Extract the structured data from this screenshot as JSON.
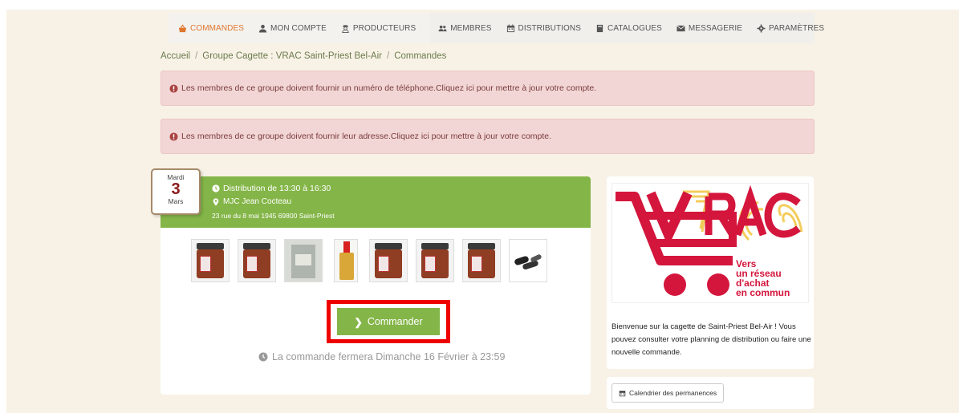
{
  "nav": {
    "left": [
      {
        "label": "COMMANDES",
        "icon": "basket-icon",
        "active": true
      },
      {
        "label": "MON COMPTE",
        "icon": "user-icon",
        "active": false
      },
      {
        "label": "PRODUCTEURS",
        "icon": "farmer-icon",
        "active": false
      }
    ],
    "right": [
      {
        "label": "MEMBRES",
        "icon": "users-icon"
      },
      {
        "label": "DISTRIBUTIONS",
        "icon": "calendar-icon"
      },
      {
        "label": "CATALOGUES",
        "icon": "book-icon"
      },
      {
        "label": "MESSAGERIE",
        "icon": "envelope-icon"
      },
      {
        "label": "PARAMÈTRES",
        "icon": "gear-icon"
      }
    ],
    "active_color": "#e0762e"
  },
  "breadcrumb": {
    "items": [
      "Accueil",
      "Groupe Cagette : VRAC Saint-Priest Bel-Air",
      "Commandes"
    ],
    "separator": "/"
  },
  "alerts": [
    {
      "text": "Les membres de ce groupe doivent fournir un numéro de téléphone. ",
      "link": "Cliquez ici pour mettre à jour votre compte."
    },
    {
      "text": "Les membres de ce groupe doivent fournir leur adresse. ",
      "link": "Cliquez ici pour mettre à jour votre compte."
    }
  ],
  "distribution": {
    "day_name": "Mardi",
    "day_number": "3",
    "month": "Mars",
    "time": "Distribution de 13:30 à 16:30",
    "place": "MJC Jean Cocteau",
    "address": "23 rue du 8 mai 1945 69800 Saint-Priest",
    "order_button": "Commander",
    "closing_note": "La commande fermera Dimanche 16 Février à 23:59",
    "accent_color": "#84b548",
    "highlight_color": "#ee0000"
  },
  "logo": {
    "word": "VRAC",
    "tagline": [
      "Vers",
      "un réseau",
      "d'achat",
      "en commun"
    ],
    "brand_color": "#d4163c",
    "accent_color": "#f2c84b"
  },
  "side": {
    "welcome": "Bienvenue sur la cagette de Saint-Priest Bel-Air ! Vous pouvez consulter votre planning de distribution ou faire une nouvelle commande.",
    "calendar_button": "Calendrier des permanences"
  }
}
